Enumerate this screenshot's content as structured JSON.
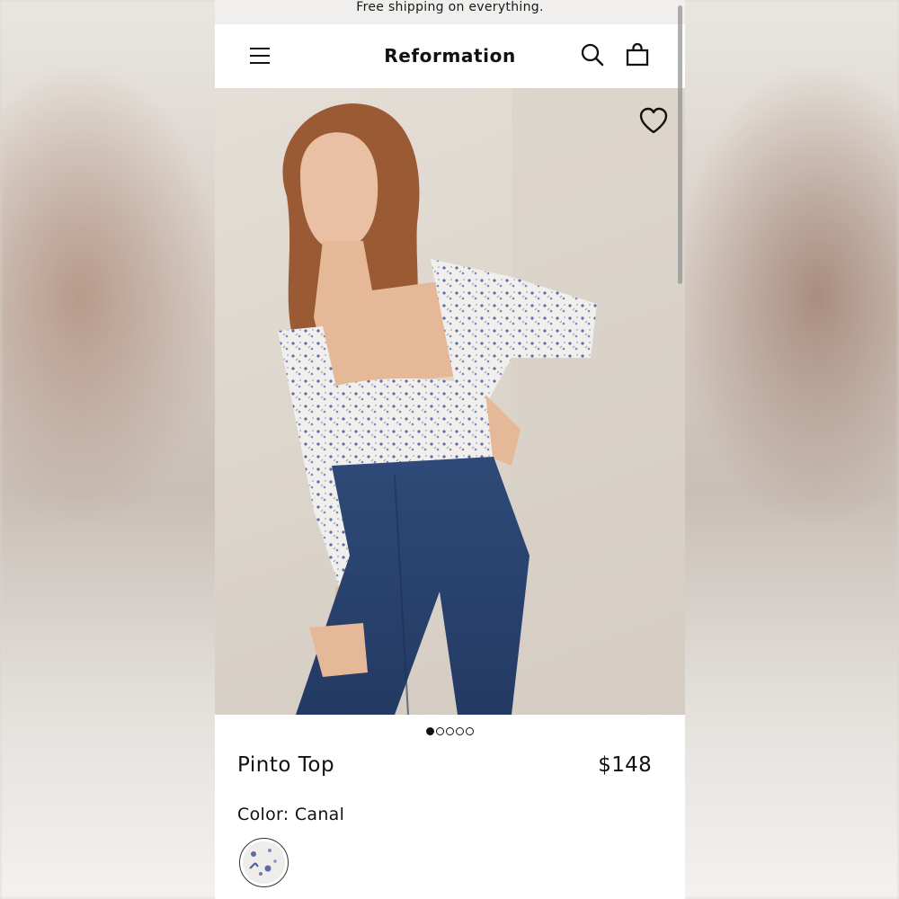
{
  "promo_banner": "Free shipping on everything.",
  "header": {
    "brand": "Reformation",
    "icons": [
      "menu-icon",
      "search-icon",
      "shopping-bag-icon"
    ]
  },
  "gallery": {
    "image_count": 5,
    "active_index": 0,
    "wishlist_icon": "heart-icon"
  },
  "product": {
    "name": "Pinto Top",
    "price": "$148",
    "color_label": "Color: Canal"
  },
  "colors": {
    "text": "#111111",
    "background": "#ffffff",
    "floral_print": "#5d6aa8"
  }
}
